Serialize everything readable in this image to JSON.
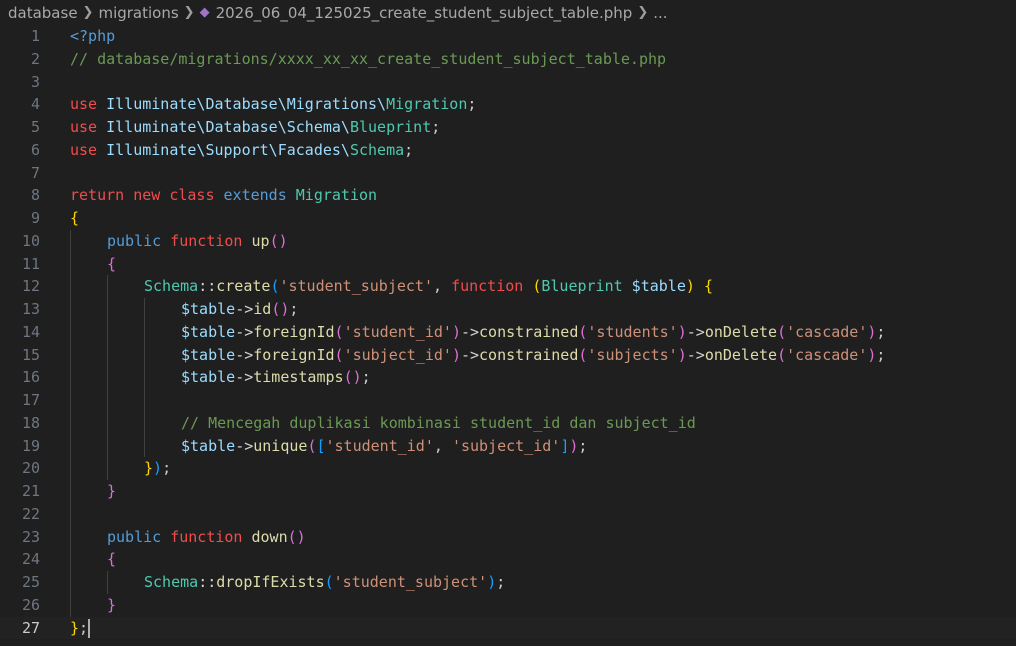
{
  "breadcrumb": {
    "items": [
      "database",
      "migrations",
      "2026_06_04_125025_create_student_subject_table.php",
      "..."
    ],
    "file_icon": "php-elephant-icon"
  },
  "editor": {
    "current_line": 27,
    "lines": [
      {
        "n": 1,
        "indent": 0,
        "tokens": [
          {
            "t": "<?php",
            "c": "php"
          }
        ]
      },
      {
        "n": 2,
        "indent": 0,
        "tokens": [
          {
            "t": "// database/migrations/xxxx_xx_xx_create_student_subject_table.php",
            "c": "com"
          }
        ]
      },
      {
        "n": 3,
        "indent": 0,
        "tokens": []
      },
      {
        "n": 4,
        "indent": 0,
        "tokens": [
          {
            "t": "use ",
            "c": "red"
          },
          {
            "t": "Illuminate\\Database\\Migrations\\",
            "c": "ns"
          },
          {
            "t": "Migration",
            "c": "type"
          },
          {
            "t": ";",
            "c": "txt"
          }
        ]
      },
      {
        "n": 5,
        "indent": 0,
        "tokens": [
          {
            "t": "use ",
            "c": "red"
          },
          {
            "t": "Illuminate\\Database\\Schema\\",
            "c": "ns"
          },
          {
            "t": "Blueprint",
            "c": "type"
          },
          {
            "t": ";",
            "c": "txt"
          }
        ]
      },
      {
        "n": 6,
        "indent": 0,
        "tokens": [
          {
            "t": "use ",
            "c": "red"
          },
          {
            "t": "Illuminate\\Support\\Facades\\",
            "c": "ns"
          },
          {
            "t": "Schema",
            "c": "type"
          },
          {
            "t": ";",
            "c": "txt"
          }
        ]
      },
      {
        "n": 7,
        "indent": 0,
        "tokens": []
      },
      {
        "n": 8,
        "indent": 0,
        "tokens": [
          {
            "t": "return ",
            "c": "red"
          },
          {
            "t": "new ",
            "c": "red"
          },
          {
            "t": "class ",
            "c": "red"
          },
          {
            "t": "extends ",
            "c": "kw"
          },
          {
            "t": "Migration",
            "c": "type"
          }
        ]
      },
      {
        "n": 9,
        "indent": 0,
        "tokens": [
          {
            "t": "{",
            "c": "b1"
          }
        ]
      },
      {
        "n": 10,
        "indent": 1,
        "tokens": [
          {
            "t": "public ",
            "c": "kw"
          },
          {
            "t": "function ",
            "c": "red"
          },
          {
            "t": "up",
            "c": "fn"
          },
          {
            "t": "()",
            "c": "b2"
          }
        ]
      },
      {
        "n": 11,
        "indent": 1,
        "tokens": [
          {
            "t": "{",
            "c": "b2"
          }
        ]
      },
      {
        "n": 12,
        "indent": 2,
        "tokens": [
          {
            "t": "Schema",
            "c": "type"
          },
          {
            "t": "::",
            "c": "op"
          },
          {
            "t": "create",
            "c": "fn"
          },
          {
            "t": "(",
            "c": "b3"
          },
          {
            "t": "'student_subject'",
            "c": "str"
          },
          {
            "t": ", ",
            "c": "txt"
          },
          {
            "t": "function ",
            "c": "red"
          },
          {
            "t": "(",
            "c": "b1"
          },
          {
            "t": "Blueprint",
            "c": "type"
          },
          {
            "t": " $table",
            "c": "var"
          },
          {
            "t": ")",
            "c": "b1"
          },
          {
            "t": " ",
            "c": "txt"
          },
          {
            "t": "{",
            "c": "b1"
          }
        ]
      },
      {
        "n": 13,
        "indent": 3,
        "tokens": [
          {
            "t": "$table",
            "c": "var"
          },
          {
            "t": "->",
            "c": "op"
          },
          {
            "t": "id",
            "c": "fn"
          },
          {
            "t": "()",
            "c": "b2"
          },
          {
            "t": ";",
            "c": "txt"
          }
        ]
      },
      {
        "n": 14,
        "indent": 3,
        "tokens": [
          {
            "t": "$table",
            "c": "var"
          },
          {
            "t": "->",
            "c": "op"
          },
          {
            "t": "foreignId",
            "c": "fn"
          },
          {
            "t": "(",
            "c": "b2"
          },
          {
            "t": "'student_id'",
            "c": "str"
          },
          {
            "t": ")",
            "c": "b2"
          },
          {
            "t": "->",
            "c": "op"
          },
          {
            "t": "constrained",
            "c": "fn"
          },
          {
            "t": "(",
            "c": "b2"
          },
          {
            "t": "'students'",
            "c": "str"
          },
          {
            "t": ")",
            "c": "b2"
          },
          {
            "t": "->",
            "c": "op"
          },
          {
            "t": "onDelete",
            "c": "fn"
          },
          {
            "t": "(",
            "c": "b2"
          },
          {
            "t": "'cascade'",
            "c": "str"
          },
          {
            "t": ")",
            "c": "b2"
          },
          {
            "t": ";",
            "c": "txt"
          }
        ]
      },
      {
        "n": 15,
        "indent": 3,
        "tokens": [
          {
            "t": "$table",
            "c": "var"
          },
          {
            "t": "->",
            "c": "op"
          },
          {
            "t": "foreignId",
            "c": "fn"
          },
          {
            "t": "(",
            "c": "b2"
          },
          {
            "t": "'subject_id'",
            "c": "str"
          },
          {
            "t": ")",
            "c": "b2"
          },
          {
            "t": "->",
            "c": "op"
          },
          {
            "t": "constrained",
            "c": "fn"
          },
          {
            "t": "(",
            "c": "b2"
          },
          {
            "t": "'subjects'",
            "c": "str"
          },
          {
            "t": ")",
            "c": "b2"
          },
          {
            "t": "->",
            "c": "op"
          },
          {
            "t": "onDelete",
            "c": "fn"
          },
          {
            "t": "(",
            "c": "b2"
          },
          {
            "t": "'cascade'",
            "c": "str"
          },
          {
            "t": ")",
            "c": "b2"
          },
          {
            "t": ";",
            "c": "txt"
          }
        ]
      },
      {
        "n": 16,
        "indent": 3,
        "tokens": [
          {
            "t": "$table",
            "c": "var"
          },
          {
            "t": "->",
            "c": "op"
          },
          {
            "t": "timestamps",
            "c": "fn"
          },
          {
            "t": "()",
            "c": "b2"
          },
          {
            "t": ";",
            "c": "txt"
          }
        ]
      },
      {
        "n": 17,
        "indent": 3,
        "tokens": []
      },
      {
        "n": 18,
        "indent": 3,
        "tokens": [
          {
            "t": "// Mencegah duplikasi kombinasi student_id dan subject_id",
            "c": "com"
          }
        ]
      },
      {
        "n": 19,
        "indent": 3,
        "tokens": [
          {
            "t": "$table",
            "c": "var"
          },
          {
            "t": "->",
            "c": "op"
          },
          {
            "t": "unique",
            "c": "fn"
          },
          {
            "t": "(",
            "c": "b2"
          },
          {
            "t": "[",
            "c": "b3"
          },
          {
            "t": "'student_id'",
            "c": "str"
          },
          {
            "t": ", ",
            "c": "txt"
          },
          {
            "t": "'subject_id'",
            "c": "str"
          },
          {
            "t": "]",
            "c": "b3"
          },
          {
            "t": ")",
            "c": "b2"
          },
          {
            "t": ";",
            "c": "txt"
          }
        ]
      },
      {
        "n": 20,
        "indent": 2,
        "tokens": [
          {
            "t": "}",
            "c": "b1"
          },
          {
            "t": ")",
            "c": "b3"
          },
          {
            "t": ";",
            "c": "txt"
          }
        ]
      },
      {
        "n": 21,
        "indent": 1,
        "tokens": [
          {
            "t": "}",
            "c": "b2"
          }
        ]
      },
      {
        "n": 22,
        "indent": 1,
        "tokens": []
      },
      {
        "n": 23,
        "indent": 1,
        "tokens": [
          {
            "t": "public ",
            "c": "kw"
          },
          {
            "t": "function ",
            "c": "red"
          },
          {
            "t": "down",
            "c": "fn"
          },
          {
            "t": "()",
            "c": "b2"
          }
        ]
      },
      {
        "n": 24,
        "indent": 1,
        "tokens": [
          {
            "t": "{",
            "c": "b2"
          }
        ]
      },
      {
        "n": 25,
        "indent": 2,
        "tokens": [
          {
            "t": "Schema",
            "c": "type"
          },
          {
            "t": "::",
            "c": "op"
          },
          {
            "t": "dropIfExists",
            "c": "fn"
          },
          {
            "t": "(",
            "c": "b3"
          },
          {
            "t": "'student_subject'",
            "c": "str"
          },
          {
            "t": ")",
            "c": "b3"
          },
          {
            "t": ";",
            "c": "txt"
          }
        ]
      },
      {
        "n": 26,
        "indent": 1,
        "tokens": [
          {
            "t": "}",
            "c": "b2"
          }
        ]
      },
      {
        "n": 27,
        "indent": 0,
        "tokens": [
          {
            "t": "}",
            "c": "b1"
          },
          {
            "t": ";",
            "c": "txt"
          }
        ]
      }
    ]
  },
  "colors": {
    "background": "#1f1f1f",
    "keyword": "#569cd6",
    "storage": "#f14c4c",
    "type": "#4ec9b0",
    "function": "#dcdcaa",
    "string": "#ce9178",
    "comment": "#6a9955",
    "variable": "#9cdcfe"
  }
}
